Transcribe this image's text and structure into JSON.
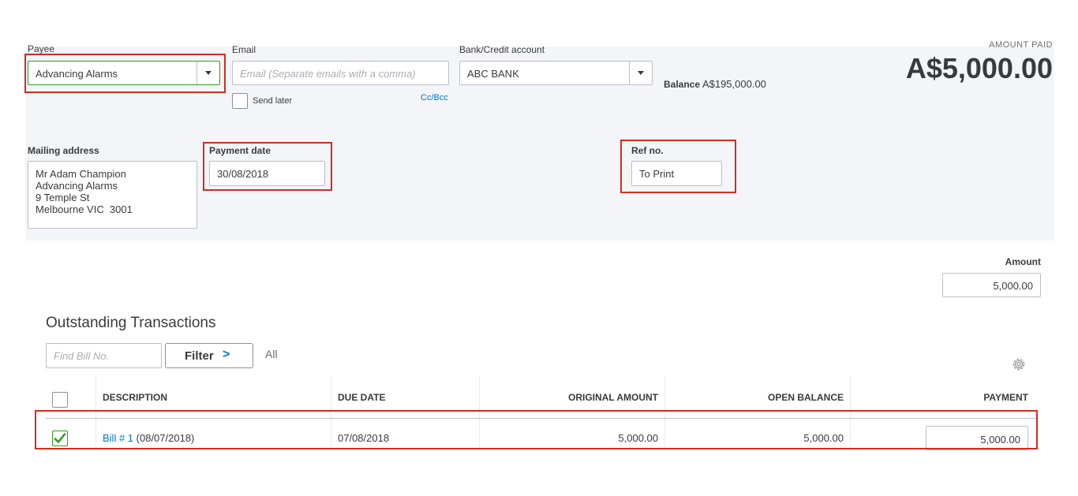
{
  "payee": {
    "label": "Payee",
    "value": "Advancing Alarms"
  },
  "email": {
    "label": "Email",
    "placeholder": "Email (Separate emails with a comma)",
    "send_later": "Send later",
    "cc_bcc": "Cc/Bcc"
  },
  "bank": {
    "label": "Bank/Credit account",
    "value": "ABC BANK",
    "balance_label": "Balance",
    "balance_value": "A$195,000.00"
  },
  "amount_paid": {
    "label": "AMOUNT PAID",
    "value": "A$5,000.00"
  },
  "mailing": {
    "label": "Mailing address",
    "lines": [
      "Mr Adam Champion",
      "Advancing Alarms",
      "9 Temple St",
      "Melbourne VIC  3001"
    ]
  },
  "payment_date": {
    "label": "Payment date",
    "value": "30/08/2018"
  },
  "ref": {
    "label": "Ref no.",
    "value": "To Print"
  },
  "amount": {
    "label": "Amount",
    "value": "5,000.00"
  },
  "outstanding": {
    "title": "Outstanding Transactions",
    "find_placeholder": "Find Bill No.",
    "filter_label": "Filter",
    "filter_chevron": ">",
    "all_label": "All",
    "gear_icon": "gear-icon"
  },
  "table": {
    "headers": [
      "DESCRIPTION",
      "DUE DATE",
      "ORIGINAL AMOUNT",
      "OPEN BALANCE",
      "PAYMENT"
    ],
    "rows": [
      {
        "link": "Bill # 1",
        "date_suffix": "(08/07/2018)",
        "due": "07/08/2018",
        "original": "5,000.00",
        "open": "5,000.00",
        "payment": "5,000.00",
        "checked": true
      }
    ]
  },
  "colors": {
    "panel_bg": "#f4f5f8",
    "highlight": "#d52b1e",
    "link": "#0077c5",
    "check": "#2ca01c"
  }
}
